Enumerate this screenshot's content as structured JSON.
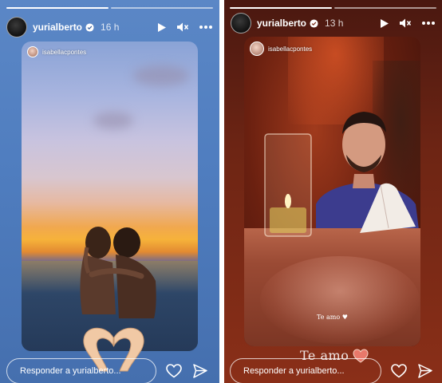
{
  "stories": [
    {
      "username": "yurialberto",
      "time": "16 h",
      "shared_from": "isabellacpontes",
      "reply_placeholder": "Responder a yurialberto..."
    },
    {
      "username": "yurialberto",
      "time": "13 h",
      "shared_from": "isabellacpontes",
      "sticker_text": "Te amo",
      "sticker_heart": "♥",
      "reply_placeholder": "Responder a yurialberto...",
      "overlay_caption": "Te amo"
    }
  ],
  "colors": {
    "verified_badge": "#3897f0",
    "left_bg": "#4f7dbf",
    "right_bg": "#6e2514"
  },
  "icons": [
    "verified-icon",
    "play-icon",
    "mute-icon",
    "more-icon",
    "heart-icon",
    "send-icon",
    "heart-hands-icon",
    "heart-sticker-icon"
  ]
}
